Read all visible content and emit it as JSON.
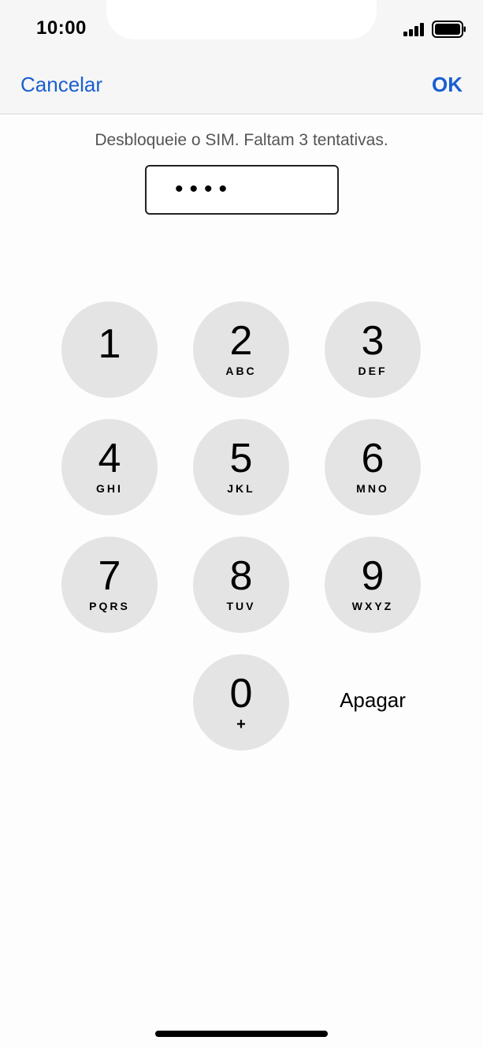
{
  "status_bar": {
    "time": "10:00",
    "icons": [
      "signal-icon",
      "battery-icon"
    ]
  },
  "nav": {
    "cancel_label": "Cancelar",
    "ok_label": "OK"
  },
  "prompt": "Desbloqueie o SIM. Faltam 3 tentativas.",
  "pin": {
    "masked_value": "••••"
  },
  "keypad": {
    "k1": {
      "digit": "1",
      "letters": ""
    },
    "k2": {
      "digit": "2",
      "letters": "ABC"
    },
    "k3": {
      "digit": "3",
      "letters": "DEF"
    },
    "k4": {
      "digit": "4",
      "letters": "GHI"
    },
    "k5": {
      "digit": "5",
      "letters": "JKL"
    },
    "k6": {
      "digit": "6",
      "letters": "MNO"
    },
    "k7": {
      "digit": "7",
      "letters": "PQRS"
    },
    "k8": {
      "digit": "8",
      "letters": "TUV"
    },
    "k9": {
      "digit": "9",
      "letters": "WXYZ"
    },
    "k0": {
      "digit": "0",
      "sub": "+"
    },
    "delete_label": "Apagar"
  },
  "colors": {
    "accent": "#1a5fd0",
    "key_background": "#e4e4e4",
    "top_bar": "#f6f6f6"
  }
}
